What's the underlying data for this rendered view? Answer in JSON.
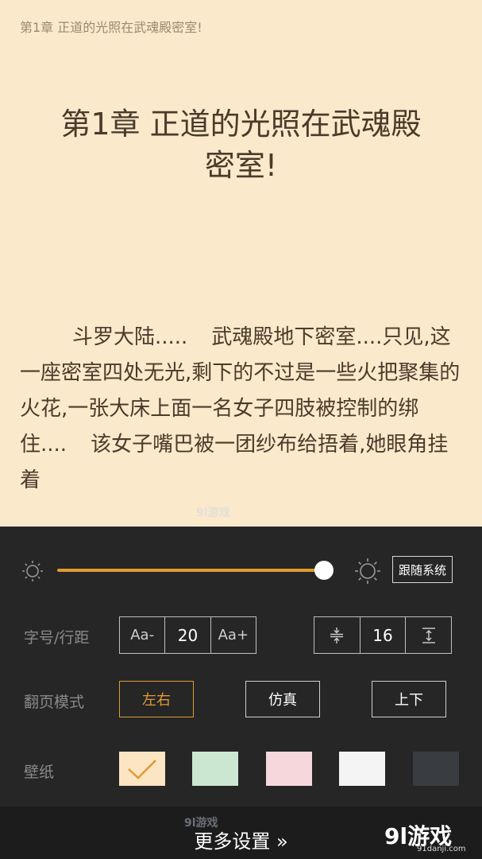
{
  "reader": {
    "running_header": "第1章  正道的光照在武魂殿密室!",
    "chapter_title_line1": "第1章 正道的光照在武魂殿",
    "chapter_title_line2": "密室!",
    "paragraph_part1": "斗罗大陆.....",
    "paragraph_part2": "武魂殿地下密室....只见,这一座密室四处无光,剩下的不过是一些火把聚集的火花,一张大床上面一名女子四肢被控制的绑住....",
    "paragraph_part3": "该女子嘴巴被一团纱布给捂着,她眼角挂着"
  },
  "settings": {
    "brightness_level": 0.96,
    "follow_system": "跟随系统",
    "font_label": "字号/行距",
    "font_decrease": "Aa-",
    "font_size": "20",
    "font_increase": "Aa+",
    "line_spacing": "16",
    "page_mode_label": "翻页模式",
    "page_modes": [
      "左右",
      "仿真",
      "上下"
    ],
    "page_mode_selected": "左右",
    "wallpaper_label": "壁纸",
    "wallpapers": [
      "#fbe5c3",
      "#cbe6d1",
      "#f6d8dc",
      "#f4f4f4",
      "#393c40"
    ],
    "accent_color": "#e09a32",
    "more_settings": "更多设置 »"
  },
  "watermark": {
    "brand": "9l游戏",
    "url": "91danji.com",
    "faint_text": "9l游戏"
  }
}
